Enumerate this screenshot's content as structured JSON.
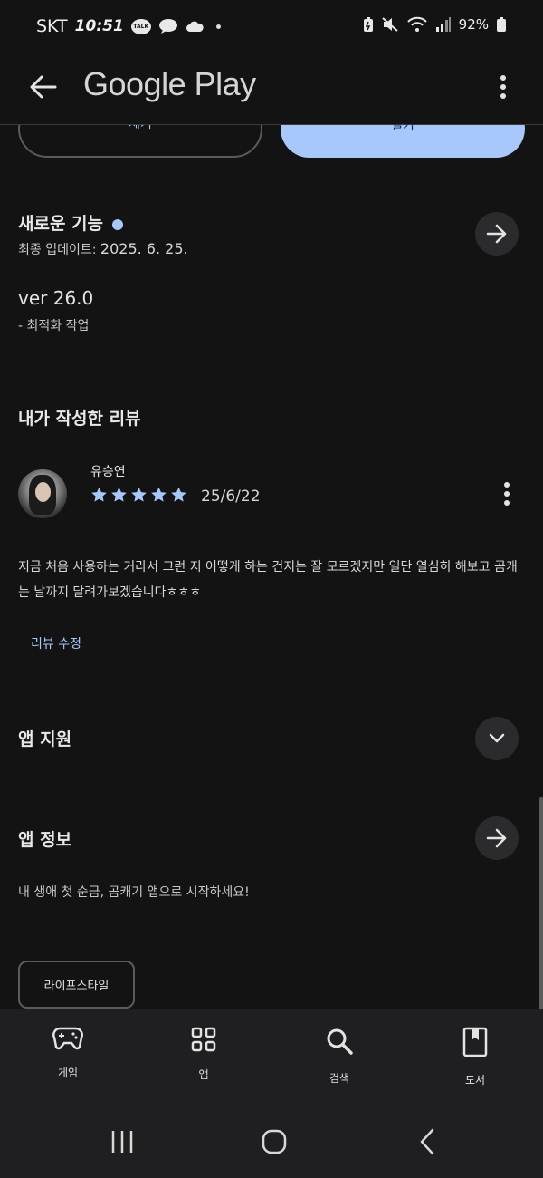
{
  "status_bar": {
    "carrier": "SKT",
    "time": "10:51",
    "kakao_label": "TALK",
    "battery": "92%"
  },
  "app_bar": {
    "title": "Google Play"
  },
  "top_buttons": {
    "outline_label": "제거",
    "filled_label": "열기"
  },
  "whats_new": {
    "title": "새로운 기능",
    "last_updated_label": "최종 업데이트:",
    "last_updated_date": "2025. 6. 25.",
    "version": "ver 26.0",
    "notes": "- 최적화 작업"
  },
  "my_review": {
    "section_title": "내가 작성한 리뷰",
    "reviewer_name": "유승연",
    "rating": 5,
    "date": "25/6/22",
    "text": "지금 처음 사용하는 거라서 그런 지 어떻게 하는 건지는 잘 모르겠지만 일단 열심히 해보고 곰캐는 날까지 달려가보겠습니다ㅎㅎㅎ",
    "edit_label": "리뷰 수정"
  },
  "app_support": {
    "title": "앱 지원"
  },
  "app_info": {
    "title": "앱 정보",
    "description": "내 생애 첫 순금, 곰캐기 앱으로 시작하세요!",
    "category_chip": "라이프스타일"
  },
  "bottom_nav": {
    "items": [
      {
        "label": "게임",
        "icon": "gamepad-icon"
      },
      {
        "label": "앱",
        "icon": "apps-grid-icon"
      },
      {
        "label": "검색",
        "icon": "search-icon"
      },
      {
        "label": "도서",
        "icon": "book-icon"
      }
    ]
  },
  "colors": {
    "background": "#131314",
    "accent": "#a8c7fa",
    "surface": "#2b2b2d"
  }
}
